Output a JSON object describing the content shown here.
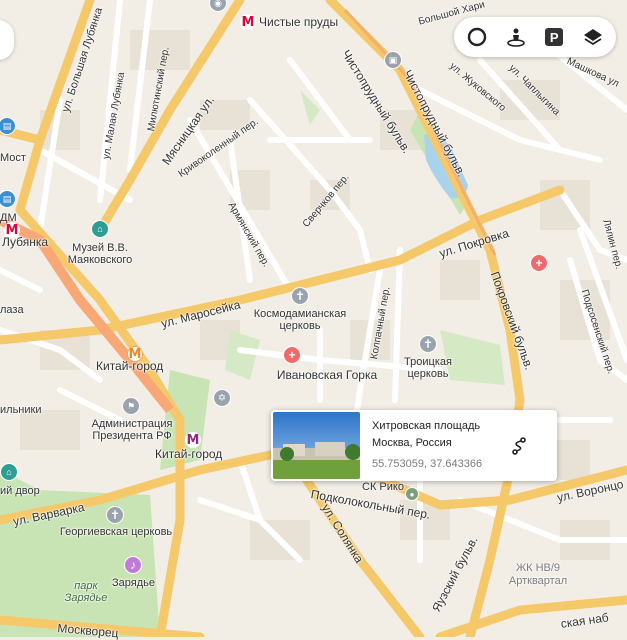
{
  "toolbar": {
    "buttons": [
      {
        "name": "traffic-icon"
      },
      {
        "name": "panorama-icon"
      },
      {
        "name": "parking-icon",
        "label": "P"
      },
      {
        "name": "layers-icon"
      }
    ]
  },
  "streets": {
    "bolshaya_lubyanka": "ул. Большая Лубянка",
    "malaya_lubyanka": "ул. Малая Лубянка",
    "milyutinsky": "Милютинский пер.",
    "myasnitskaya": "Мясницкая ул.",
    "krivokolenny": "Кривоколенный пер.",
    "armyansky": "Армянский пер.",
    "sverchkov": "Сверчков пер.",
    "chistoprudny": "Чистопрудный бульв.",
    "bolshoy_khar": "Большой Хари",
    "zhukovskogo": "ул. Жуковского",
    "chaplygina": "ул. Чаплыгина",
    "mashkova": "Машкова ул",
    "pokrovka": "ул. Покровка",
    "maroseyka": "ул. Маросейка",
    "kolpachny": "Колпачный пер.",
    "pokrovsky": "Покровский бульв.",
    "lyalin": "Лялин пер.",
    "podsosensky": "Подсосенский пер.",
    "podkolokolny": "Подколокольный пер.",
    "vorontsovo": "ул. Воронцо",
    "varvarka": "ул. Варварка",
    "solyanka": "ул. Солянка",
    "yauzsky": "Яузский бульв.",
    "moskvoretskaya": "Москворец",
    "naberezhnaya": "ская наб",
    "zlaza": "лаза",
    "lnikovsky": "ильники",
    "bulv_top": "бульв."
  },
  "places": {
    "chistye_prudy": "Чистые пруды",
    "most": "Мост",
    "dm": "ДМ",
    "lubyanka": "Лубянка",
    "museum_line1": "Музей В.В.",
    "museum_line2": "Маяковского",
    "kosmodamian_line1": "Космодамианская",
    "kosmodamian_line2": "церковь",
    "ivanovskaya": "Ивановская Горка",
    "kitay_gorod_1": "Китай-город",
    "kitay_gorod_2": "Китай-город",
    "troitskaya_line1": "Троицкая",
    "troitskaya_line2": "церковь",
    "admin_line1": "Администрация",
    "admin_line2": "Президента РФ",
    "gostiny_dvor": "ий двор",
    "georgievskaya": "Георгиевская церковь",
    "zaryadye": "Зарядье",
    "park_line1": "парк",
    "park_line2": "Зарядье",
    "sk_riko": "СК Рико",
    "zhk_line1": "ЖК НВ/9",
    "zhk_line2": "Артквартал"
  },
  "card": {
    "title": "Хитровская площадь",
    "address": "Москва, Россия",
    "coords": "55.753059, 37.643366"
  },
  "colors": {
    "background": "#f2eee6",
    "road_major": "#f5c96a",
    "road_minor": "#ffffff",
    "park": "#c9e4b4",
    "water": "#a9d3ea",
    "metro": "#d6083b",
    "poi_grey": "#9aa3ad",
    "poi_teal": "#2e9e95",
    "poi_red": "#ef6b6b",
    "poi_blue": "#3a8fd6",
    "poi_purple": "#c27ad6"
  }
}
